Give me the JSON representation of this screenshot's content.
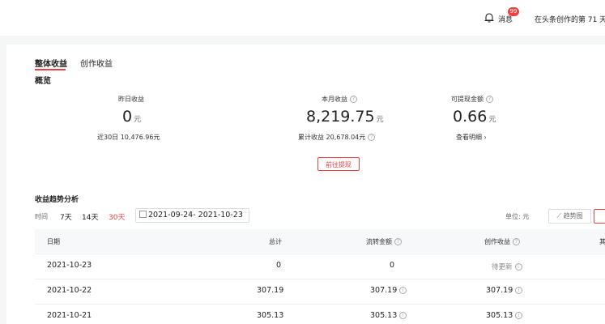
{
  "header": {
    "notification_count": "99",
    "notification_label": "消息",
    "creation_days": "在头条创作的第 71 天"
  },
  "tabs": [
    {
      "label": "整体收益"
    },
    {
      "label": "创作收益"
    }
  ],
  "overview": {
    "title": "概览",
    "yesterday": {
      "label": "昨日收益",
      "value": "0",
      "unit": "元",
      "sub": "近30日 10,476.96元"
    },
    "month": {
      "label": "本月收益",
      "value": "8,219.75",
      "unit": "元",
      "sub": "累计收益 20,678.04元"
    },
    "withdrawable": {
      "label": "可提现金额",
      "value": "0.66",
      "unit": "元",
      "sub": "查看明细 ›"
    },
    "withdraw_button": "前往提现"
  },
  "trend": {
    "title": "收益趋势分析",
    "time_label": "时间",
    "ranges": [
      "7天",
      "14天",
      "30天"
    ],
    "active_range": "30天",
    "date_range": "2021-09-24- 2021-10-23",
    "unit_label": "单位: 元",
    "trend_button": "趋势图"
  },
  "table": {
    "headers": [
      "日期",
      "总计",
      "流转金额",
      "创作收益",
      "其"
    ],
    "rows": [
      [
        "2021-10-23",
        "0",
        "0",
        "待更新"
      ],
      [
        "2021-10-22",
        "307.19",
        "307.19",
        "307.19"
      ],
      [
        "2021-10-21",
        "305.13",
        "305.13",
        "305.13"
      ]
    ]
  },
  "colors": {
    "accent": "#f04142",
    "background": "#f5f6f7"
  }
}
